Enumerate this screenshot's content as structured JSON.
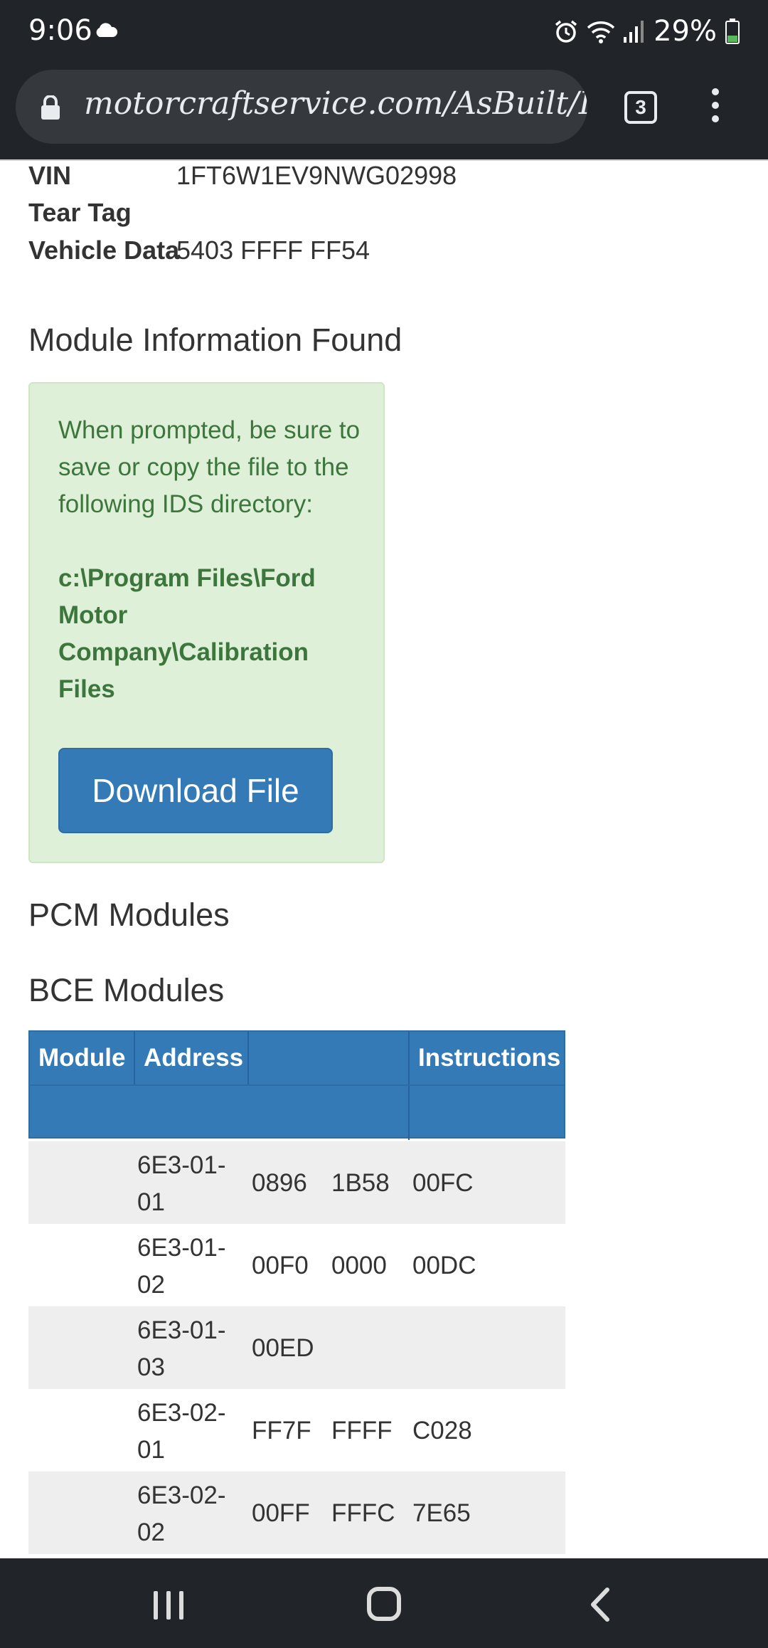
{
  "status_bar": {
    "time": "9:06",
    "battery_percent": "29%",
    "icons": [
      "cloud-icon",
      "alarm-icon",
      "wifi-icon",
      "signal-icon",
      "battery-icon"
    ]
  },
  "browser": {
    "url": "motorcraftservice.com/AsBuilt/Deta",
    "tab_count": "3"
  },
  "vehicle": {
    "vin_label": "VIN",
    "vin_value": "1FT6W1EV9NWG02998",
    "tear_tag_label": "Tear Tag",
    "tear_tag_value": "",
    "vehicle_data_label": "Vehicle Data",
    "vehicle_data_value": "5403 FFFF FF54"
  },
  "module_info": {
    "heading": "Module Information Found",
    "alert_text": "When prompted, be sure to save or copy the file to the following IDS directory:",
    "alert_path": "c:\\Program Files\\Ford Motor Company\\Calibration Files",
    "download_label": "Download File"
  },
  "pcm_heading": "PCM Modules",
  "bce_heading": "BCE Modules",
  "table": {
    "headers": [
      "Module",
      "Address",
      "",
      "Instructions"
    ],
    "rows": [
      {
        "address": "6E3-01-01",
        "d1": "0896",
        "d2": "1B58",
        "d3": "00FC"
      },
      {
        "address": "6E3-01-02",
        "d1": "00F0",
        "d2": "0000",
        "d3": "00DC"
      },
      {
        "address": "6E3-01-03",
        "d1": "00ED",
        "d2": "",
        "d3": ""
      },
      {
        "address": "6E3-02-01",
        "d1": "FF7F",
        "d2": "FFFF",
        "d3": "C028"
      },
      {
        "address": "6E3-02-02",
        "d1": "00FF",
        "d2": "FFFC",
        "d3": "7E65"
      }
    ]
  },
  "colors": {
    "primary": "#337ab7",
    "alert_bg": "#dff0d8",
    "alert_text": "#3c763d",
    "chrome_dark": "#212529"
  }
}
